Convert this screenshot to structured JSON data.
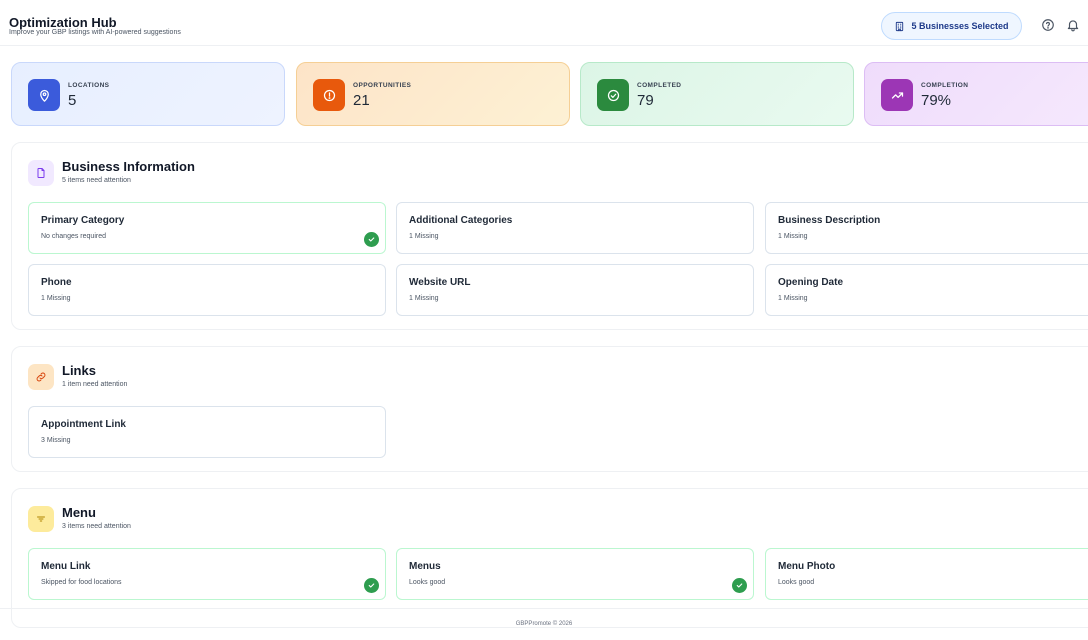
{
  "header": {
    "title": "Optimization Hub",
    "subtitle": "Improve your GBP listings with AI-powered suggestions",
    "business_button": "5 Businesses Selected",
    "help_icon": "help-circle-icon",
    "bell_icon": "bell-icon"
  },
  "stats": [
    {
      "label": "LOCATIONS",
      "value": "5",
      "icon": "map-pin-icon",
      "color": "#3b5bdb"
    },
    {
      "label": "OPPORTUNITIES",
      "value": "21",
      "icon": "alert-circle-icon",
      "color": "#e8590c"
    },
    {
      "label": "COMPLETED",
      "value": "79",
      "icon": "check-circle-icon",
      "color": "#2b8a3e"
    },
    {
      "label": "COMPLETION",
      "value": "79%",
      "icon": "trending-up-icon",
      "color": "#9c36b5"
    }
  ],
  "sections": {
    "business_info": {
      "title": "Business Information",
      "subtitle": "5 items need attention",
      "items": [
        {
          "title": "Primary Category",
          "status": "No changes required"
        },
        {
          "title": "Additional Categories",
          "status": "1 Missing"
        },
        {
          "title": "Business Description",
          "status": "1 Missing"
        },
        {
          "title": "Phone",
          "status": "1 Missing"
        },
        {
          "title": "Website URL",
          "status": "1 Missing"
        },
        {
          "title": "Opening Date",
          "status": "1 Missing"
        }
      ]
    },
    "links": {
      "title": "Links",
      "subtitle": "1 item need attention",
      "items": [
        {
          "title": "Appointment Link",
          "status": "3 Missing"
        }
      ]
    },
    "menu": {
      "title": "Menu",
      "subtitle": "3 items need attention",
      "items": [
        {
          "title": "Menu Link",
          "status": "Skipped for food locations"
        },
        {
          "title": "Menus",
          "status": "Looks good"
        },
        {
          "title": "Menu Photo",
          "status": "Looks good"
        }
      ]
    }
  },
  "footer": {
    "text": "GBPPromote © 2026"
  }
}
